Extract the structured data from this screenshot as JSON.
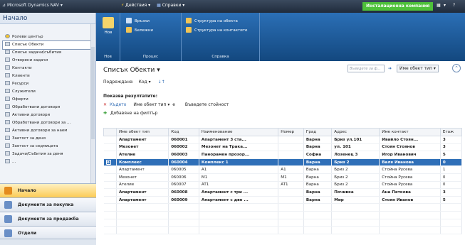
{
  "topbar": {
    "app": "Microsoft Dynamics NAV",
    "actions": "Действия",
    "reports": "Справки",
    "company": "Инсталационна компания",
    "right_icons": [
      "▾",
      "?"
    ]
  },
  "nav": {
    "header": "Начало",
    "items": [
      "Ролеви център",
      "Списък Обекти",
      "Списък задачи/събития",
      "Отворени задачи",
      "Контакти",
      "Клиенти",
      "Ресурси",
      "Служители",
      "Оферти",
      "Обработвани договори",
      "Активни договори",
      "Обработвани договори за ...",
      "Активни договори за наем",
      "Заетост за деня",
      "Заетост за седмицата",
      "Задачи/Събития за деня",
      "..."
    ],
    "buttons": [
      "Начало",
      "Документи за покупка",
      "Документи за продажба",
      "Отдели"
    ]
  },
  "ribbon": {
    "group1": {
      "button": "Нов",
      "label": "Нов"
    },
    "group2": {
      "buttons": [
        "Връзки",
        "Бележки"
      ],
      "label": "Процес"
    },
    "group3": {
      "buttons": [
        "Структура на обекта",
        "Структура на контактите"
      ],
      "label": "Справка"
    }
  },
  "page": {
    "title": "Списък Обекти",
    "title_arrow": "▾",
    "sort_label": "Подреждане:",
    "sort_value": "Код",
    "search_placeholder": "Въведете за ф...",
    "filter_field": "Име обект тип",
    "collapse": "⌃"
  },
  "filters": {
    "header": "Показва резултатите:",
    "row_key": "Където",
    "row_field": "Име обект тип",
    "row_op": "е",
    "row_value": "Въведете стойност",
    "add": "Добавяне на филтър"
  },
  "table": {
    "columns": [
      "",
      "Име обект тип",
      "Код",
      "Наименование",
      "Номер",
      "Град",
      "Адрес",
      "Име контакт",
      "Етаж"
    ],
    "rows": [
      {
        "style": "bold",
        "cells": [
          "",
          "Апартамент",
          "060001",
          "Апартамент 3 ста...",
          "",
          "Варна",
          "Бриз ул.101",
          "Ивайло Стоян...",
          "3"
        ]
      },
      {
        "style": "bold",
        "cells": [
          "",
          "Мезонет",
          "060002",
          "Мезонет на Трака...",
          "",
          "Варна",
          "ул. 101",
          "Стоян Стоянов",
          "3"
        ]
      },
      {
        "style": "bold",
        "cells": [
          "",
          "Ателие",
          "060003",
          "Панорамен прозор...",
          "",
          "Софиа",
          "Лозенец 3",
          "Игор Иванович",
          "5"
        ]
      },
      {
        "style": "sel",
        "cells": [
          "⊕",
          "Комплекс",
          "060004",
          "Комплекс 1",
          "",
          "Варна",
          "Бриз 2",
          "Валя Иванова",
          "0"
        ]
      },
      {
        "style": "normal",
        "cells": [
          "",
          "Апартамент",
          "060005",
          "A1",
          "A1",
          "Варна",
          "Бриз 2",
          "Стойна Русева",
          "1"
        ]
      },
      {
        "style": "normal",
        "cells": [
          "",
          "Мезонет",
          "060006",
          "M1",
          "M1",
          "Варна",
          "Бриз 2",
          "Стойна Русева",
          "0"
        ]
      },
      {
        "style": "normal",
        "cells": [
          "",
          "Ателие",
          "060007",
          "AT1",
          "AT1",
          "Варна",
          "Бриз 2",
          "Стойна Русева",
          "0"
        ]
      },
      {
        "style": "bold",
        "cells": [
          "",
          "Апартамент",
          "060008",
          "Апартамент с три ...",
          "",
          "Варна",
          "Почивка",
          "Ана Петкова",
          "3"
        ]
      },
      {
        "style": "bold",
        "cells": [
          "",
          "Апартамент",
          "060009",
          "Апартамент с две ...",
          "",
          "Варна",
          "Мир",
          "Стоян Иванов",
          "5"
        ]
      },
      {
        "style": "empty",
        "cells": [
          "",
          "",
          "",
          "",
          "",
          "",
          "",
          "",
          ""
        ]
      },
      {
        "style": "empty",
        "cells": [
          "",
          "",
          "",
          "",
          "",
          "",
          "",
          "",
          ""
        ]
      },
      {
        "style": "empty",
        "cells": [
          "",
          "",
          "",
          "",
          "",
          "",
          "",
          "",
          ""
        ]
      },
      {
        "style": "empty",
        "cells": [
          "",
          "",
          "",
          "",
          "",
          "",
          "",
          "",
          ""
        ]
      }
    ]
  }
}
